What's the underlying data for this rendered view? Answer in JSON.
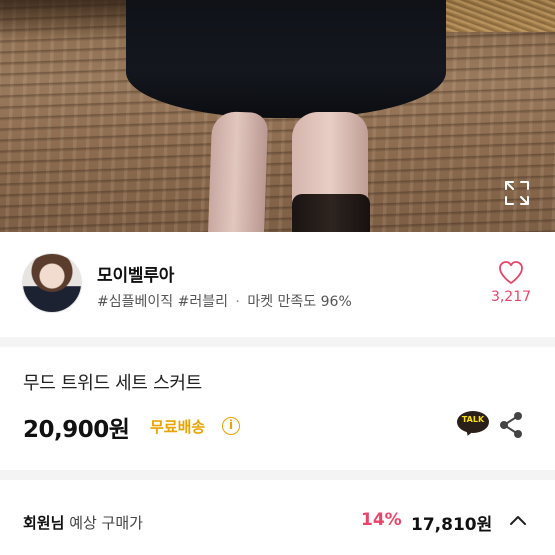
{
  "seller": {
    "name": "모이벨루아",
    "tag1": "#심플베이직",
    "tag2": "#러블리",
    "separator": "·",
    "satisfaction": "마켓 만족도 96%",
    "like_count": "3,217"
  },
  "product": {
    "title": "무드 트위드 세트 스커트",
    "price": "20,900원",
    "shipping": "무료배송",
    "info_icon_glyph": "i",
    "talk_label": "TALK"
  },
  "member_price": {
    "member_word": "회원님",
    "label": "예상 구매가",
    "discount": "14%",
    "price": "17,810원"
  },
  "colors": {
    "accent_pink": "#e8456a",
    "shipping_yellow": "#e8a300",
    "kakao_yellow": "#fae100"
  },
  "icons": [
    "expand-icon",
    "heart-icon",
    "info-icon",
    "kakao-talk-icon",
    "share-icon",
    "chevron-up-icon"
  ]
}
